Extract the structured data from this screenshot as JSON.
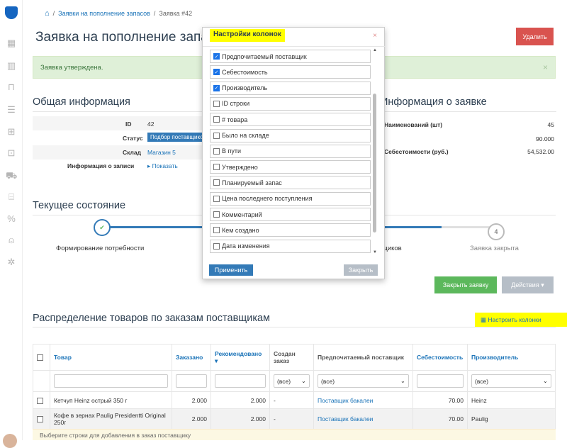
{
  "breadcrumb": {
    "section": "Заявки на пополнение запасов",
    "current": "Заявка #42"
  },
  "page_title": "Заявка на пополнение запасов",
  "delete_button": "Удалить",
  "alert": {
    "text": "Заявка утверждена.",
    "close": "×"
  },
  "general": {
    "title": "Общая информация",
    "id_label": "ID",
    "id_value": "42",
    "status_label": "Статус",
    "status_value": "Подбор поставщиков",
    "warehouse_label": "Склад",
    "warehouse_value": "Магазин 5",
    "record_label": "Информация о записи",
    "record_value": "Показать"
  },
  "request_info": {
    "title": "Информация о заявке",
    "rows": [
      {
        "label": "Наименований (шт)",
        "value": "45"
      },
      {
        "label": "",
        "value": "90.000"
      },
      {
        "label": "Себестоимости (руб.)",
        "value": "54,532.00"
      }
    ]
  },
  "state": {
    "title": "Текущее состояние",
    "step1": "Формирование потребности",
    "step3": "щиков",
    "step4_num": "4",
    "step4": "Заявка закрыта",
    "progress": 0.86
  },
  "actions": {
    "close_request": "Закрыть заявку",
    "actions": "Действия"
  },
  "distribution": {
    "title": "Распределение товаров по заказам поставщикам",
    "configure": "Настроить колонки",
    "columns": [
      "Товар",
      "Заказано",
      "Рекомендовано",
      "Создан заказ",
      "Предпочитаемый поставщик",
      "Себестоимость",
      "Производитель"
    ],
    "filters": {
      "created": "(все)",
      "supplier": "(все)",
      "maker": "(все)"
    },
    "rows": [
      {
        "product": "Кетчуп Heinz острый 350 г",
        "ordered": "2.000",
        "recommended": "2.000",
        "created": "-",
        "supplier": "Поставщик бакалеи",
        "cost": "70.00",
        "maker": "Heinz"
      },
      {
        "product": "Кофе в зернах Paulig Presidentti Original 250г",
        "ordered": "2.000",
        "recommended": "2.000",
        "created": "-",
        "supplier": "Поставщик бакалеи",
        "cost": "70.00",
        "maker": "Paulig"
      }
    ],
    "footer": "Выберите строки для добавления в заказ поставщику"
  },
  "modal": {
    "title": "Настройки колонок",
    "close": "×",
    "options": [
      {
        "label": "Предпочитаемый поставщик",
        "checked": true
      },
      {
        "label": "Себестоимость",
        "checked": true
      },
      {
        "label": "Производитель",
        "checked": true
      },
      {
        "label": "ID строки",
        "checked": false
      },
      {
        "label": "# товара",
        "checked": false
      },
      {
        "label": "Было на складе",
        "checked": false
      },
      {
        "label": "В пути",
        "checked": false
      },
      {
        "label": "Утверждено",
        "checked": false
      },
      {
        "label": "Планируемый запас",
        "checked": false
      },
      {
        "label": "Цена последнего поступления",
        "checked": false
      },
      {
        "label": "Комментарий",
        "checked": false
      },
      {
        "label": "Кем создано",
        "checked": false
      },
      {
        "label": "Дата изменения",
        "checked": false
      }
    ],
    "apply": "Применить",
    "close_button": "Закрыть"
  },
  "colors": {
    "primary": "#337ab7",
    "danger": "#d9534f",
    "success": "#5cb85c",
    "highlight": "#ffff00"
  }
}
